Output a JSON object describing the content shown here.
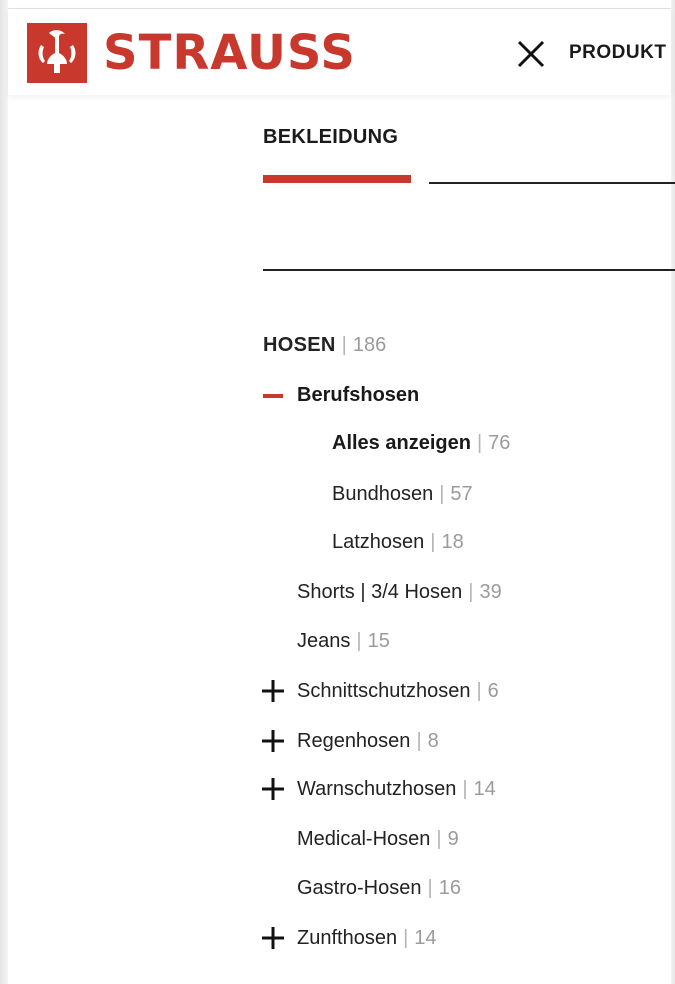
{
  "brand": {
    "name": "STRAUSS",
    "color": "#c8382d"
  },
  "header": {
    "nav_label": "PRODUKT",
    "close_icon": "close-icon"
  },
  "tabs": {
    "active_label": "BEKLEIDUNG"
  },
  "category": {
    "title": "HOSEN",
    "count": "186"
  },
  "items": [
    {
      "label": "Berufshosen",
      "count": "",
      "toggle": "minus-icon"
    },
    {
      "label": "Alles anzeigen",
      "count": "76"
    },
    {
      "label": "Bundhosen",
      "count": "57"
    },
    {
      "label": "Latzhosen",
      "count": "18"
    },
    {
      "label": "Shorts | 3/4 Hosen",
      "count": "39"
    },
    {
      "label": "Jeans",
      "count": "15"
    },
    {
      "label": "Schnittschutzhosen",
      "count": "6",
      "toggle": "plus-icon"
    },
    {
      "label": "Regenhosen",
      "count": "8",
      "toggle": "plus-icon"
    },
    {
      "label": "Warnschutzhosen",
      "count": "14",
      "toggle": "plus-icon"
    },
    {
      "label": "Medical-Hosen",
      "count": "9"
    },
    {
      "label": "Gastro-Hosen",
      "count": "16"
    },
    {
      "label": "Zunfthosen",
      "count": "14",
      "toggle": "plus-icon"
    }
  ],
  "separator": "|"
}
